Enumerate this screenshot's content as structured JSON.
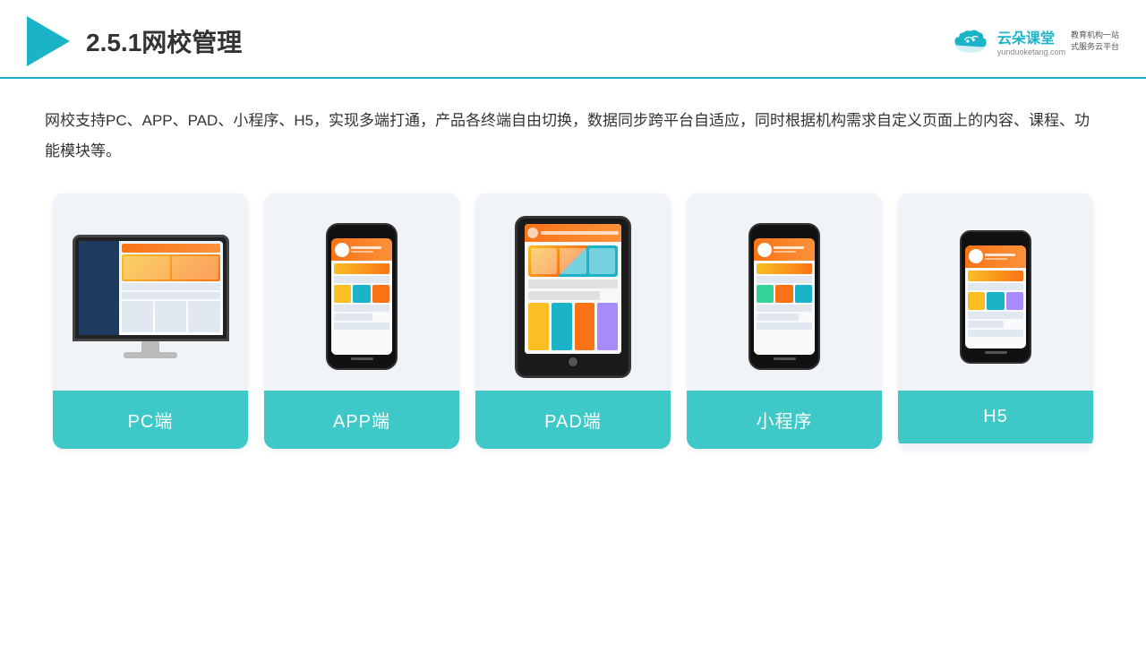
{
  "header": {
    "title": "2.5.1网校管理",
    "brand": {
      "name": "云朵课堂",
      "url": "yunduoketang.com",
      "tagline_line1": "教育机构一站",
      "tagline_line2": "式服务云平台"
    }
  },
  "description": "网校支持PC、APP、PAD、小程序、H5，实现多端打通，产品各终端自由切换，数据同步跨平台自适应，同时根据机构需求自定义页面上的内容、课程、功能模块等。",
  "cards": [
    {
      "id": "pc",
      "label": "PC端"
    },
    {
      "id": "app",
      "label": "APP端"
    },
    {
      "id": "pad",
      "label": "PAD端"
    },
    {
      "id": "miniprogram",
      "label": "小程序"
    },
    {
      "id": "h5",
      "label": "H5"
    }
  ],
  "accent_color": "#3ec8c8"
}
